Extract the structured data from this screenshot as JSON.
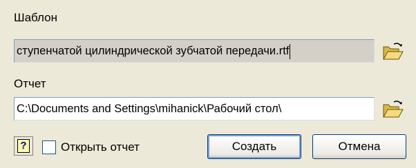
{
  "template": {
    "label": "Шаблон",
    "value": "ступенчатой цилиндрической зубчатой передачи.rtf"
  },
  "report": {
    "label": "Отчет",
    "value": "C:\\Documents and Settings\\mihanick\\Рабочий стол\\"
  },
  "options": {
    "open_report_label": "Открыть отчет",
    "open_report_checked": false
  },
  "buttons": {
    "help_glyph": "?",
    "create_label": "Создать",
    "cancel_label": "Отмена"
  },
  "icons": {
    "browse": "open-folder-icon",
    "help": "help-icon"
  },
  "colors": {
    "dialog_bg": "#ece9d8",
    "button_border": "#003c74",
    "field_border": "#7f9db9"
  }
}
